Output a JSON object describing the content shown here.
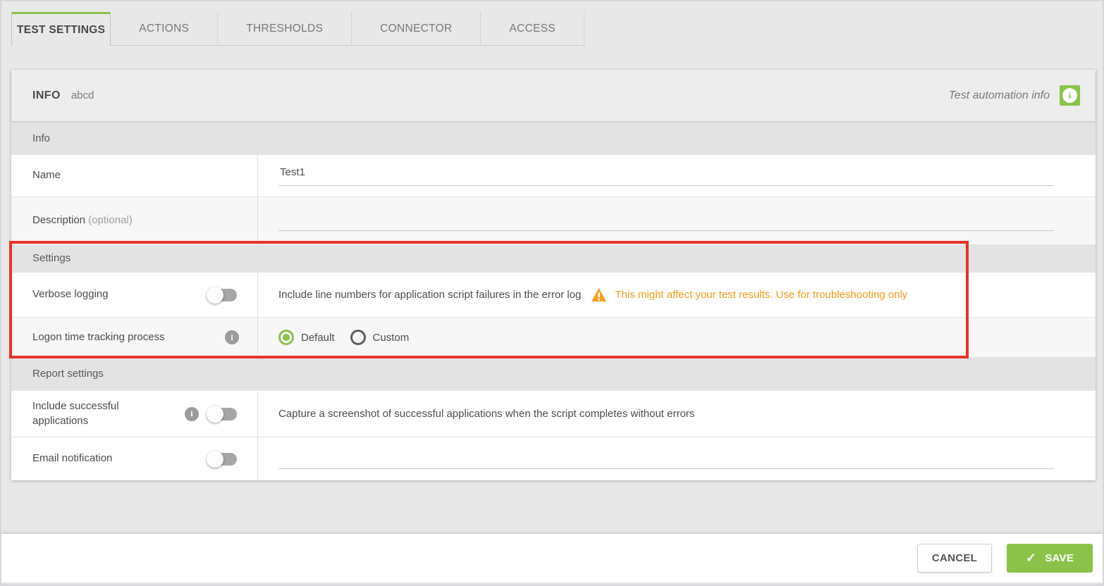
{
  "tabs": [
    {
      "label": "TEST SETTINGS",
      "active": true
    },
    {
      "label": "ACTIONS",
      "active": false
    },
    {
      "label": "THRESHOLDS",
      "active": false
    },
    {
      "label": "CONNECTOR",
      "active": false
    },
    {
      "label": "ACCESS",
      "active": false
    }
  ],
  "panel": {
    "title": "INFO",
    "subtitle": "abcd",
    "header_right_label": "Test automation info"
  },
  "sections": {
    "info": {
      "heading": "Info",
      "name": {
        "label": "Name",
        "value": "Test1"
      },
      "description": {
        "label": "Description",
        "optional": "(optional)",
        "value": ""
      }
    },
    "settings": {
      "heading": "Settings",
      "verbose_logging": {
        "label": "Verbose logging",
        "toggle_state": "off",
        "description": "Include line numbers for application script failures in the error log",
        "warning": "This might affect your test results. Use for troubleshooting only"
      },
      "logon_time": {
        "label": "Logon time tracking process",
        "options": [
          {
            "label": "Default",
            "selected": true
          },
          {
            "label": "Custom",
            "selected": false
          }
        ]
      }
    },
    "report": {
      "heading": "Report settings",
      "include_successful": {
        "label": "Include successful applications",
        "toggle_state": "off",
        "description": "Capture a screenshot of successful applications when the script completes without errors"
      },
      "email_notification": {
        "label": "Email notification",
        "toggle_state": "off",
        "value": ""
      }
    }
  },
  "footer": {
    "cancel_label": "CANCEL",
    "save_label": "SAVE"
  },
  "icons": {
    "info_glyph": "i",
    "check_glyph": "✓"
  },
  "colors": {
    "accent_green": "#8bc34a",
    "warning_orange": "#f6991c",
    "annotation_red": "#e9322d"
  }
}
